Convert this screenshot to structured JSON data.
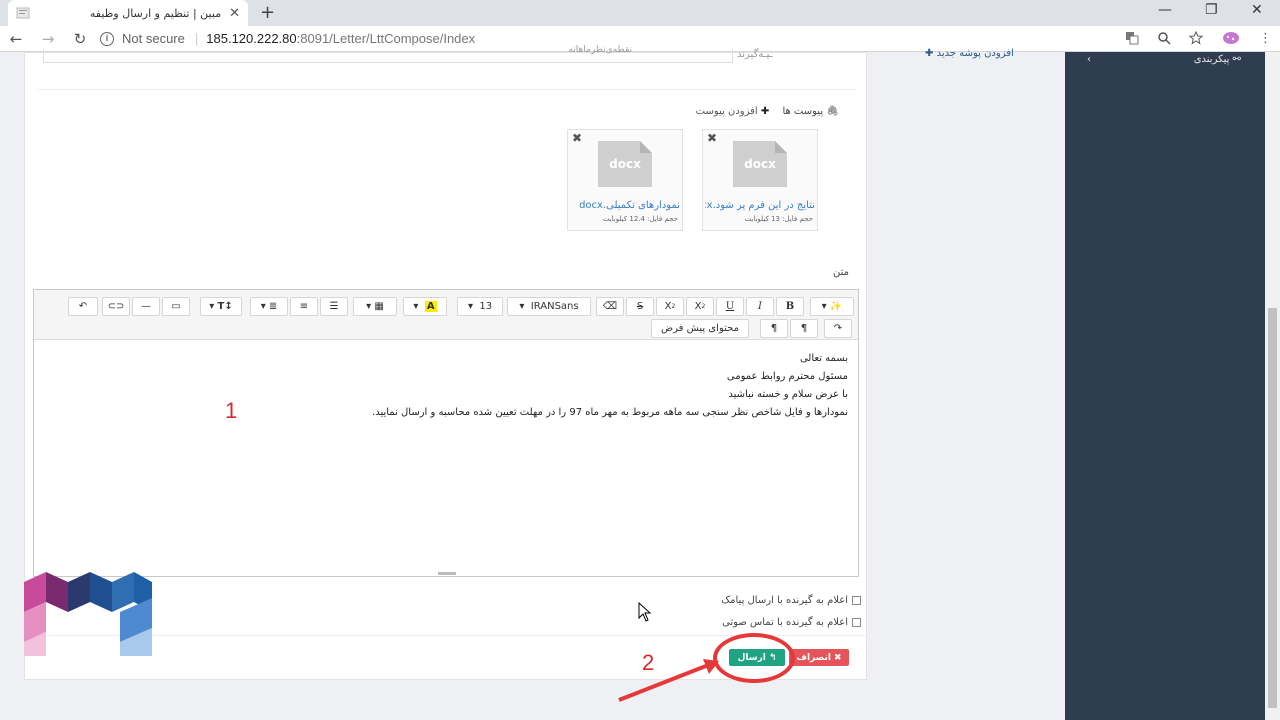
{
  "browser": {
    "tab_title": "مبین | تنظیم و ارسال وظیفه",
    "tab_close": "✕",
    "new_tab": "+",
    "back": "←",
    "forward": "→",
    "reload": "↻",
    "security_label": "Not secure",
    "url_host": "185.120.222.80",
    "url_path": ":8091/Letter/LttCompose/Index",
    "min": "—",
    "max": "❐",
    "close": "✕"
  },
  "top_fields": {
    "prev_value": "نقطه‌ی‌نظر‌ماهانه",
    "prev_label": "ـیـه‌گیرند"
  },
  "attachments": {
    "label": "پیوست ها",
    "add_label": "افزودن پیوست",
    "files": [
      {
        "ext": "docx",
        "name": "نتایج در این فرم پر شود.docx",
        "size": "حجم فایل: 13 کیلوبایت"
      },
      {
        "ext": "docx",
        "name": "نمودارهای تکمیلی.docx",
        "size": "حجم فایل: 12.4 کیلوبایت"
      }
    ]
  },
  "body_label": "متن",
  "toolbar": {
    "font_name": "IRANSans",
    "font_size": "13",
    "default_content": "محتوای پیش فرض"
  },
  "editor": {
    "lines": [
      "بسمه تعالی",
      "مسئول محترم روابط عمومی",
      "با عرض سلام و خسته نباشید",
      "نمودارها و فایل شاخص نظر سنجی سه ماهه مربوط به مهر ماه 97 را در مهلت تعیین شده محاسبه و ارسال نمایید."
    ]
  },
  "notify": {
    "sms": "اعلام به گیرنده با ارسال پیامک",
    "voice": "اعلام به گیرنده با تماس صوتی"
  },
  "actions": {
    "send": "ارسال",
    "cancel": "انصراف"
  },
  "sidebar": {
    "add_folder": "افزودن پوشه جدید",
    "settings": "پیکربندی"
  },
  "annotations": {
    "step1": "1",
    "step2": "2"
  },
  "colors": {
    "send": "#1fa383",
    "cancel": "#e5545a",
    "sidebar": "#2e3d4f",
    "annotation": "#e53838"
  }
}
